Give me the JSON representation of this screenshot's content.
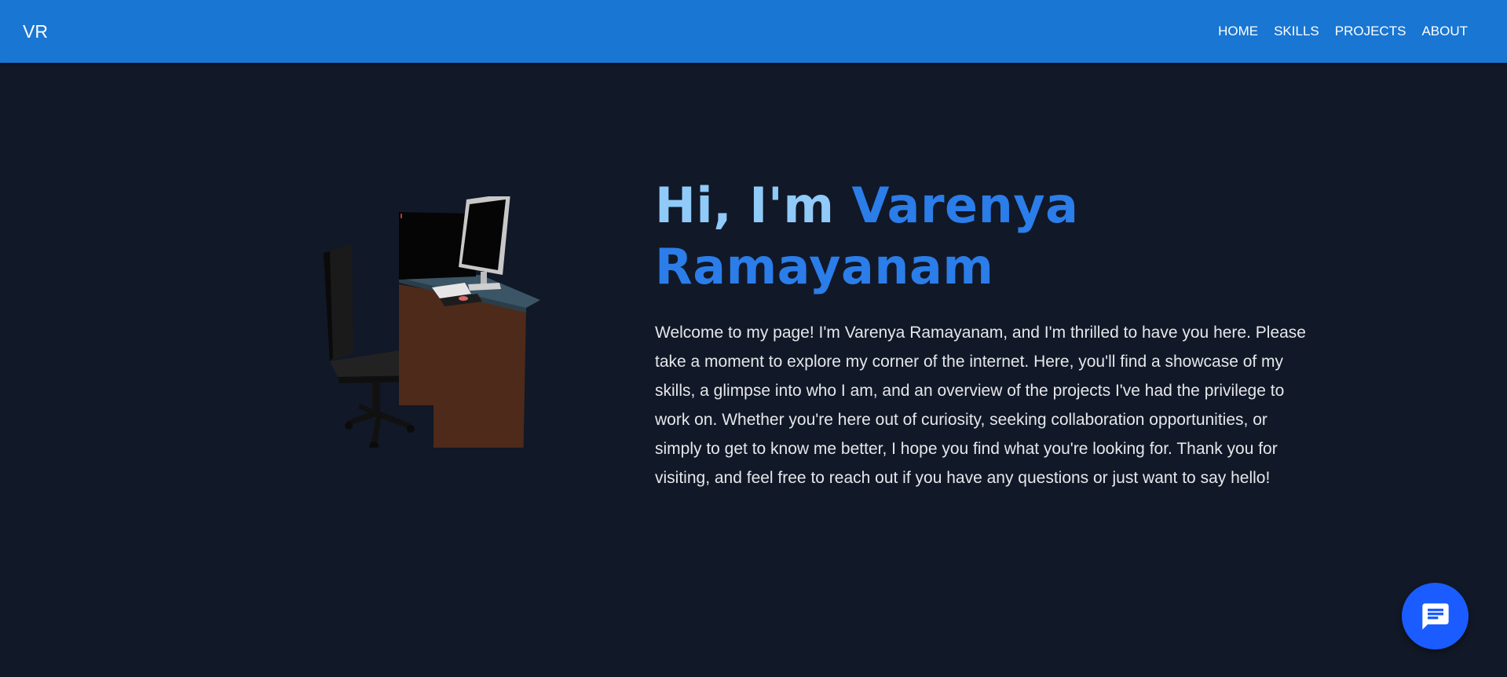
{
  "nav": {
    "brand": "VR",
    "links": [
      {
        "label": "HOME"
      },
      {
        "label": "SKILLS"
      },
      {
        "label": "PROJECTS"
      },
      {
        "label": "ABOUT"
      }
    ]
  },
  "hero": {
    "greeting": "Hi, I'm ",
    "name": "Varenya Ramayanam",
    "intro": "Welcome to my page! I'm Varenya Ramayanam, and I'm thrilled to have you here. Please take a moment to explore my corner of the internet. Here, you'll find a showcase of my skills, a glimpse into who I am, and an overview of the projects I've had the privilege to work on. Whether you're here out of curiosity, seeking collaboration opportunities, or simply to get to know me better, I hope you find what you're looking for. Thank you for visiting, and feel free to reach out if you have any questions or just want to say hello!"
  },
  "chat": {
    "icon": "chat-icon"
  },
  "colors": {
    "navbar": "#1976d2",
    "background": "#111827",
    "greeting": "#90caf9",
    "name": "#2b7de9",
    "chat_button": "#1a5cff"
  }
}
